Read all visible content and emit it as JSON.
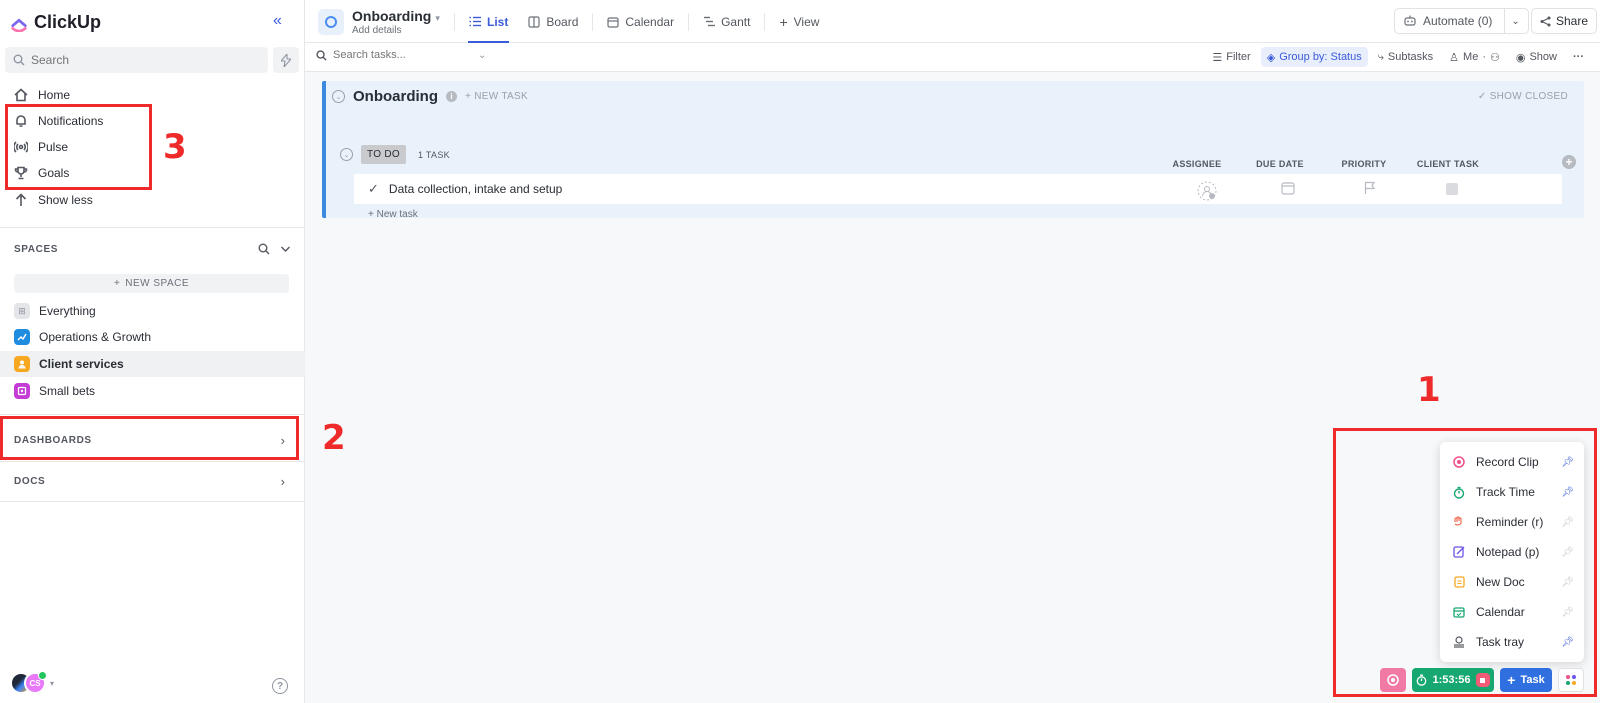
{
  "app": {
    "name": "ClickUp"
  },
  "sidebar": {
    "search_placeholder": "Search",
    "nav": [
      {
        "label": "Home",
        "icon": "home-icon"
      },
      {
        "label": "Notifications",
        "icon": "bell-icon"
      },
      {
        "label": "Pulse",
        "icon": "pulse-icon"
      },
      {
        "label": "Goals",
        "icon": "trophy-icon"
      },
      {
        "label": "Show less",
        "icon": "arrow-up-icon"
      }
    ],
    "spaces_title": "SPACES",
    "new_space_label": "NEW SPACE",
    "spaces": [
      {
        "label": "Everything",
        "color": "#d9dbde"
      },
      {
        "label": "Operations & Growth",
        "color": "#1f8ce0"
      },
      {
        "label": "Client services",
        "color": "#f6a821",
        "active": true
      },
      {
        "label": "Small bets",
        "color": "#c43bd6"
      }
    ],
    "dashboards_label": "DASHBOARDS",
    "docs_label": "DOCS",
    "user_initials": "CS"
  },
  "annotations": [
    "1",
    "2",
    "3"
  ],
  "topbar": {
    "list_title": "Onboarding",
    "list_subtitle": "Add details",
    "tabs": [
      {
        "label": "List",
        "active": true
      },
      {
        "label": "Board"
      },
      {
        "label": "Calendar"
      },
      {
        "label": "Gantt"
      }
    ],
    "add_view_label": "View",
    "automate_label": "Automate (0)",
    "share_label": "Share"
  },
  "filterbar": {
    "search_placeholder": "Search tasks...",
    "filter_label": "Filter",
    "group_by_label": "Group by: Status",
    "subtasks_label": "Subtasks",
    "me_label": "Me",
    "show_label": "Show"
  },
  "list": {
    "group_title": "Onboarding",
    "new_task_label": "+ NEW TASK",
    "show_closed_label": "SHOW CLOSED",
    "status_label": "TO DO",
    "task_count": "1 TASK",
    "columns": [
      "ASSIGNEE",
      "DUE DATE",
      "PRIORITY",
      "CLIENT TASK"
    ],
    "tasks": [
      {
        "name": "Data collection, intake and setup"
      }
    ],
    "add_task_label": "+ New task"
  },
  "tray": {
    "items": [
      {
        "label": "Record Clip",
        "color": "#f0508a",
        "pinned": true
      },
      {
        "label": "Track Time",
        "color": "#16a870",
        "pinned": true
      },
      {
        "label": "Reminder (r)",
        "color": "#f06a50",
        "pinned": false
      },
      {
        "label": "Notepad (p)",
        "color": "#6b54e8",
        "pinned": false
      },
      {
        "label": "New Doc",
        "color": "#f6a821",
        "pinned": false
      },
      {
        "label": "Calendar",
        "color": "#16a870",
        "pinned": false
      },
      {
        "label": "Task tray",
        "color": "#53575e",
        "pinned": true
      }
    ]
  },
  "bottom_bar": {
    "timer_value": "1:53:56",
    "task_button_label": "Task"
  }
}
